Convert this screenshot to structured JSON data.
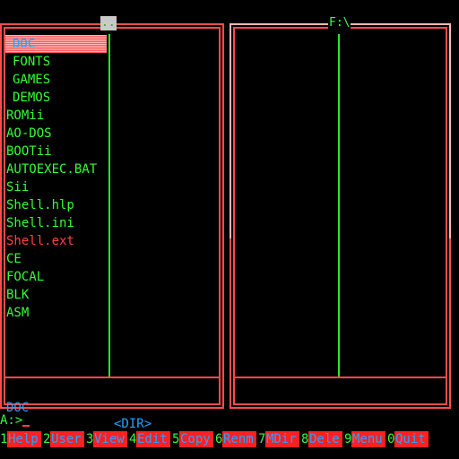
{
  "left_panel": {
    "title": "..",
    "files": [
      {
        "name": "DOC",
        "dir": true,
        "selected": true
      },
      {
        "name": "FONTS",
        "dir": true
      },
      {
        "name": "GAMES",
        "dir": true
      },
      {
        "name": "DEMOS",
        "dir": true
      },
      {
        "name": "ROMii"
      },
      {
        "name": "AO-DOS"
      },
      {
        "name": "BOOTii"
      },
      {
        "name": "AUTOEXEC.BAT"
      },
      {
        "name": "Sii"
      },
      {
        "name": "Shell.hlp"
      },
      {
        "name": "Shell.ini"
      },
      {
        "name": "Shell.ext",
        "highlight": true
      },
      {
        "name": "CE"
      },
      {
        "name": "FOCAL"
      },
      {
        "name": "BLK"
      },
      {
        "name": "ASM"
      }
    ],
    "status_name": "DOC",
    "status_type": "<DIR>"
  },
  "right_panel": {
    "title": "F:\\"
  },
  "command_line": {
    "prompt": "A:>"
  },
  "function_keys": [
    {
      "num": "1",
      "label": "Help"
    },
    {
      "num": "2",
      "label": "User"
    },
    {
      "num": "3",
      "label": "View"
    },
    {
      "num": "4",
      "label": "Edit"
    },
    {
      "num": "5",
      "label": "Copy"
    },
    {
      "num": "6",
      "label": "Renm"
    },
    {
      "num": "7",
      "label": "MDir"
    },
    {
      "num": "8",
      "label": "Dele"
    },
    {
      "num": "9",
      "label": "Menu"
    },
    {
      "num": "0",
      "label": "Quit"
    }
  ],
  "colors": {
    "background": "#000000",
    "frame": "#ff4b4b",
    "text": "#33ff33",
    "accent": "#2aa0ff",
    "key_bg": "#ff2020"
  }
}
